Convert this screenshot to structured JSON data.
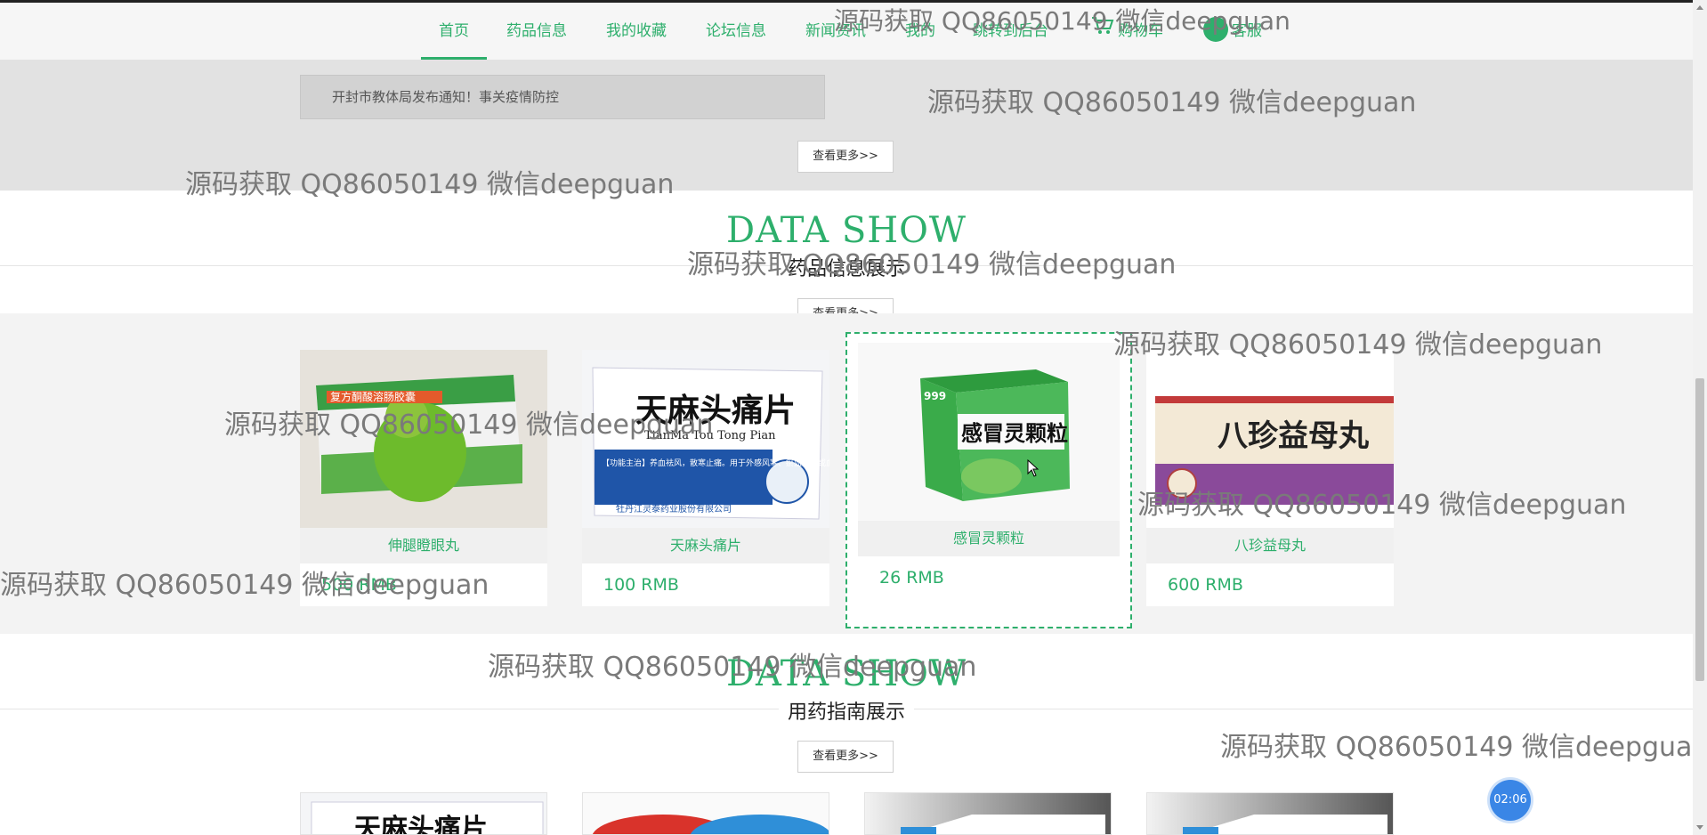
{
  "nav": {
    "items": [
      "首页",
      "药品信息",
      "我的收藏",
      "论坛信息",
      "新闻资讯",
      "我的",
      "跳转到后台",
      "购物车",
      "客服"
    ],
    "active_index": 0,
    "icons": [
      "cart-icon",
      "customer-service-icon"
    ]
  },
  "news": {
    "item": "开封市教体局发布通知！事关疫情防控",
    "more": "查看更多>>"
  },
  "products_section": {
    "ds_title": "DATA SHOW",
    "subtitle": "药品信息展示",
    "more": "查看更多>>",
    "items": [
      {
        "name": "伸腿瞪眼丸",
        "price": "500 RMB"
      },
      {
        "name": "天麻头痛片",
        "price": "100 RMB"
      },
      {
        "name": "感冒灵颗粒",
        "price": "26 RMB"
      },
      {
        "name": "八珍益母丸",
        "price": "600 RMB"
      }
    ],
    "image_text": {
      "p1": "复方酮酸溶肠胶囊",
      "p2_title": "天麻头痛片",
      "p2_pinyin": "TianMa Tou Tong Pian",
      "p2_desc": "【功能主治】养血祛风，散寒止痛。用于外感风寒、瘀血阻滞或血虚失养所致的偏正头痛、恶寒、鼻塞。",
      "p2_maker": "牡丹江灵泰药业股份有限公司",
      "p3_brand": "999",
      "p3_title": "感冒灵颗粒",
      "p4_title": "八珍益母丸"
    }
  },
  "guide_section": {
    "ds_title": "DATA SHOW",
    "subtitle": "用药指南展示",
    "more": "查看更多>>",
    "guide_partial_text": "天麻头痛片"
  },
  "watermark": "源码获取 QQ86050149 微信deepguan",
  "timer": "02:06",
  "colors": {
    "accent": "#2eaf6c",
    "band_gray": "#e2e2e2",
    "timer_blue": "#3a86e6"
  }
}
